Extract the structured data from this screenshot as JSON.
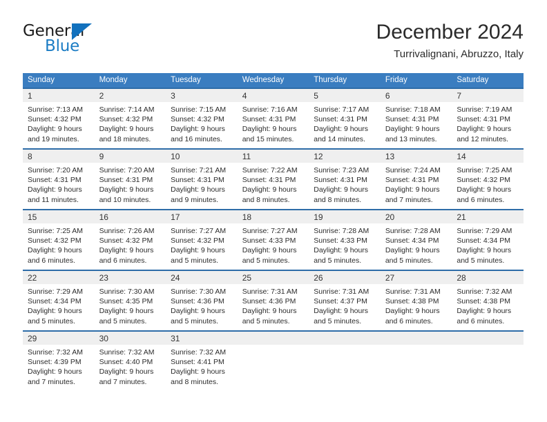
{
  "brand": {
    "name_part1": "General",
    "name_part2": "Blue",
    "triangle_icon": "blue-triangle-icon",
    "accent_color": "#1b7cc4"
  },
  "header": {
    "title": "December 2024",
    "subtitle": "Turrivalignani, Abruzzo, Italy"
  },
  "theme": {
    "header_bg": "#3a7dc0",
    "cell_border": "#2d6ca8",
    "daynum_bg": "#efefef",
    "text": "#2b2b2b"
  },
  "weekdays": [
    "Sunday",
    "Monday",
    "Tuesday",
    "Wednesday",
    "Thursday",
    "Friday",
    "Saturday"
  ],
  "weeks": [
    [
      {
        "day": "1",
        "sunrise": "Sunrise: 7:13 AM",
        "sunset": "Sunset: 4:32 PM",
        "daylight1": "Daylight: 9 hours",
        "daylight2": "and 19 minutes."
      },
      {
        "day": "2",
        "sunrise": "Sunrise: 7:14 AM",
        "sunset": "Sunset: 4:32 PM",
        "daylight1": "Daylight: 9 hours",
        "daylight2": "and 18 minutes."
      },
      {
        "day": "3",
        "sunrise": "Sunrise: 7:15 AM",
        "sunset": "Sunset: 4:32 PM",
        "daylight1": "Daylight: 9 hours",
        "daylight2": "and 16 minutes."
      },
      {
        "day": "4",
        "sunrise": "Sunrise: 7:16 AM",
        "sunset": "Sunset: 4:31 PM",
        "daylight1": "Daylight: 9 hours",
        "daylight2": "and 15 minutes."
      },
      {
        "day": "5",
        "sunrise": "Sunrise: 7:17 AM",
        "sunset": "Sunset: 4:31 PM",
        "daylight1": "Daylight: 9 hours",
        "daylight2": "and 14 minutes."
      },
      {
        "day": "6",
        "sunrise": "Sunrise: 7:18 AM",
        "sunset": "Sunset: 4:31 PM",
        "daylight1": "Daylight: 9 hours",
        "daylight2": "and 13 minutes."
      },
      {
        "day": "7",
        "sunrise": "Sunrise: 7:19 AM",
        "sunset": "Sunset: 4:31 PM",
        "daylight1": "Daylight: 9 hours",
        "daylight2": "and 12 minutes."
      }
    ],
    [
      {
        "day": "8",
        "sunrise": "Sunrise: 7:20 AM",
        "sunset": "Sunset: 4:31 PM",
        "daylight1": "Daylight: 9 hours",
        "daylight2": "and 11 minutes."
      },
      {
        "day": "9",
        "sunrise": "Sunrise: 7:20 AM",
        "sunset": "Sunset: 4:31 PM",
        "daylight1": "Daylight: 9 hours",
        "daylight2": "and 10 minutes."
      },
      {
        "day": "10",
        "sunrise": "Sunrise: 7:21 AM",
        "sunset": "Sunset: 4:31 PM",
        "daylight1": "Daylight: 9 hours",
        "daylight2": "and 9 minutes."
      },
      {
        "day": "11",
        "sunrise": "Sunrise: 7:22 AM",
        "sunset": "Sunset: 4:31 PM",
        "daylight1": "Daylight: 9 hours",
        "daylight2": "and 8 minutes."
      },
      {
        "day": "12",
        "sunrise": "Sunrise: 7:23 AM",
        "sunset": "Sunset: 4:31 PM",
        "daylight1": "Daylight: 9 hours",
        "daylight2": "and 8 minutes."
      },
      {
        "day": "13",
        "sunrise": "Sunrise: 7:24 AM",
        "sunset": "Sunset: 4:31 PM",
        "daylight1": "Daylight: 9 hours",
        "daylight2": "and 7 minutes."
      },
      {
        "day": "14",
        "sunrise": "Sunrise: 7:25 AM",
        "sunset": "Sunset: 4:32 PM",
        "daylight1": "Daylight: 9 hours",
        "daylight2": "and 6 minutes."
      }
    ],
    [
      {
        "day": "15",
        "sunrise": "Sunrise: 7:25 AM",
        "sunset": "Sunset: 4:32 PM",
        "daylight1": "Daylight: 9 hours",
        "daylight2": "and 6 minutes."
      },
      {
        "day": "16",
        "sunrise": "Sunrise: 7:26 AM",
        "sunset": "Sunset: 4:32 PM",
        "daylight1": "Daylight: 9 hours",
        "daylight2": "and 6 minutes."
      },
      {
        "day": "17",
        "sunrise": "Sunrise: 7:27 AM",
        "sunset": "Sunset: 4:32 PM",
        "daylight1": "Daylight: 9 hours",
        "daylight2": "and 5 minutes."
      },
      {
        "day": "18",
        "sunrise": "Sunrise: 7:27 AM",
        "sunset": "Sunset: 4:33 PM",
        "daylight1": "Daylight: 9 hours",
        "daylight2": "and 5 minutes."
      },
      {
        "day": "19",
        "sunrise": "Sunrise: 7:28 AM",
        "sunset": "Sunset: 4:33 PM",
        "daylight1": "Daylight: 9 hours",
        "daylight2": "and 5 minutes."
      },
      {
        "day": "20",
        "sunrise": "Sunrise: 7:28 AM",
        "sunset": "Sunset: 4:34 PM",
        "daylight1": "Daylight: 9 hours",
        "daylight2": "and 5 minutes."
      },
      {
        "day": "21",
        "sunrise": "Sunrise: 7:29 AM",
        "sunset": "Sunset: 4:34 PM",
        "daylight1": "Daylight: 9 hours",
        "daylight2": "and 5 minutes."
      }
    ],
    [
      {
        "day": "22",
        "sunrise": "Sunrise: 7:29 AM",
        "sunset": "Sunset: 4:34 PM",
        "daylight1": "Daylight: 9 hours",
        "daylight2": "and 5 minutes."
      },
      {
        "day": "23",
        "sunrise": "Sunrise: 7:30 AM",
        "sunset": "Sunset: 4:35 PM",
        "daylight1": "Daylight: 9 hours",
        "daylight2": "and 5 minutes."
      },
      {
        "day": "24",
        "sunrise": "Sunrise: 7:30 AM",
        "sunset": "Sunset: 4:36 PM",
        "daylight1": "Daylight: 9 hours",
        "daylight2": "and 5 minutes."
      },
      {
        "day": "25",
        "sunrise": "Sunrise: 7:31 AM",
        "sunset": "Sunset: 4:36 PM",
        "daylight1": "Daylight: 9 hours",
        "daylight2": "and 5 minutes."
      },
      {
        "day": "26",
        "sunrise": "Sunrise: 7:31 AM",
        "sunset": "Sunset: 4:37 PM",
        "daylight1": "Daylight: 9 hours",
        "daylight2": "and 5 minutes."
      },
      {
        "day": "27",
        "sunrise": "Sunrise: 7:31 AM",
        "sunset": "Sunset: 4:38 PM",
        "daylight1": "Daylight: 9 hours",
        "daylight2": "and 6 minutes."
      },
      {
        "day": "28",
        "sunrise": "Sunrise: 7:32 AM",
        "sunset": "Sunset: 4:38 PM",
        "daylight1": "Daylight: 9 hours",
        "daylight2": "and 6 minutes."
      }
    ],
    [
      {
        "day": "29",
        "sunrise": "Sunrise: 7:32 AM",
        "sunset": "Sunset: 4:39 PM",
        "daylight1": "Daylight: 9 hours",
        "daylight2": "and 7 minutes."
      },
      {
        "day": "30",
        "sunrise": "Sunrise: 7:32 AM",
        "sunset": "Sunset: 4:40 PM",
        "daylight1": "Daylight: 9 hours",
        "daylight2": "and 7 minutes."
      },
      {
        "day": "31",
        "sunrise": "Sunrise: 7:32 AM",
        "sunset": "Sunset: 4:41 PM",
        "daylight1": "Daylight: 9 hours",
        "daylight2": "and 8 minutes."
      },
      {
        "day": "",
        "sunrise": "",
        "sunset": "",
        "daylight1": "",
        "daylight2": ""
      },
      {
        "day": "",
        "sunrise": "",
        "sunset": "",
        "daylight1": "",
        "daylight2": ""
      },
      {
        "day": "",
        "sunrise": "",
        "sunset": "",
        "daylight1": "",
        "daylight2": ""
      },
      {
        "day": "",
        "sunrise": "",
        "sunset": "",
        "daylight1": "",
        "daylight2": ""
      }
    ]
  ]
}
